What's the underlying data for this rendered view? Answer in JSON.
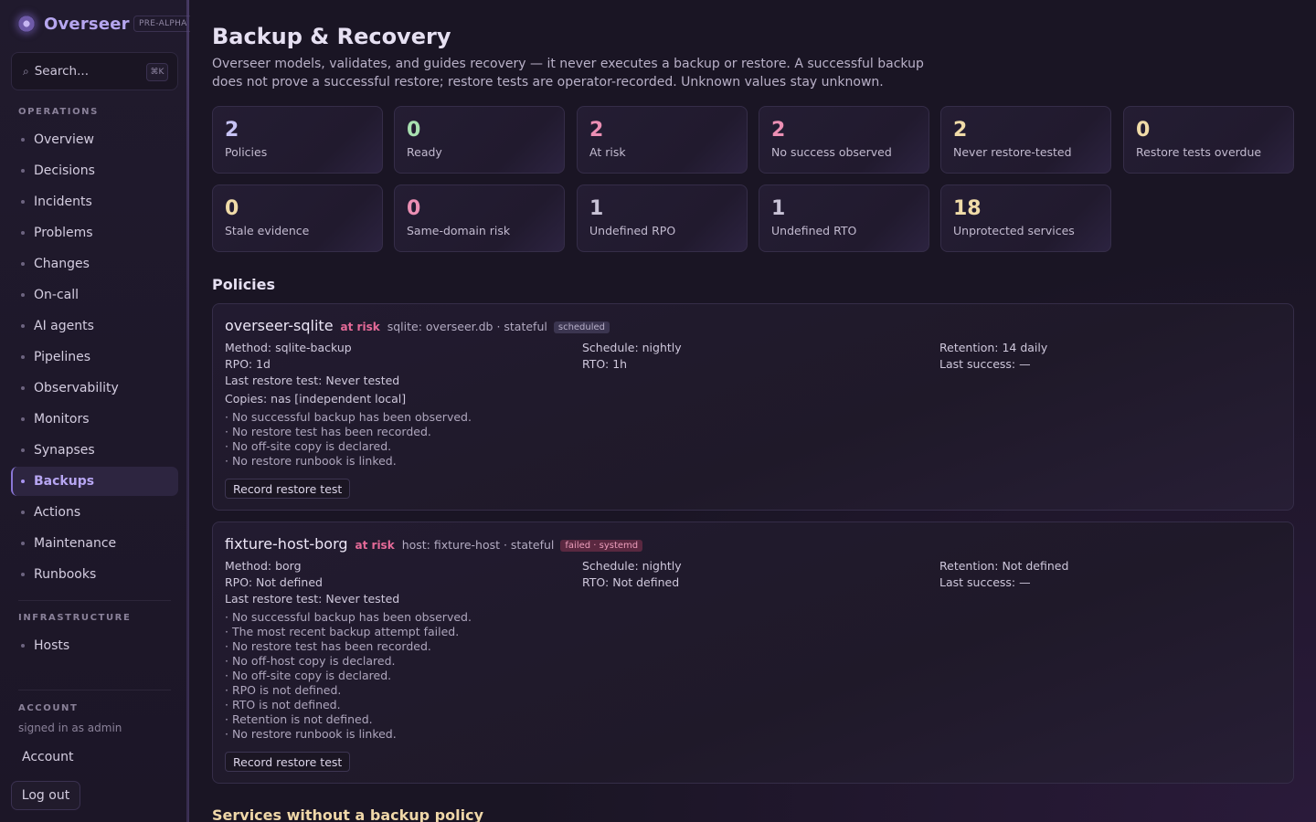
{
  "app": {
    "name": "Overseer",
    "badge": "PRE-ALPHA"
  },
  "search": {
    "placeholder": "Search...",
    "shortcut": "⌘K"
  },
  "sidebar": {
    "operations_label": "OPERATIONS",
    "operations": [
      {
        "label": "Overview"
      },
      {
        "label": "Decisions"
      },
      {
        "label": "Incidents"
      },
      {
        "label": "Problems"
      },
      {
        "label": "Changes"
      },
      {
        "label": "On-call"
      },
      {
        "label": "AI agents"
      },
      {
        "label": "Pipelines"
      },
      {
        "label": "Observability"
      },
      {
        "label": "Monitors"
      },
      {
        "label": "Synapses"
      },
      {
        "label": "Backups"
      },
      {
        "label": "Actions"
      },
      {
        "label": "Maintenance"
      },
      {
        "label": "Runbooks"
      }
    ],
    "infrastructure_label": "INFRASTRUCTURE",
    "infrastructure": [
      {
        "label": "Hosts"
      }
    ],
    "account_label": "ACCOUNT",
    "signed_in": "signed in as admin",
    "account_link": "Account",
    "logout": "Log out"
  },
  "page": {
    "title": "Backup & Recovery",
    "description": "Overseer models, validates, and guides recovery — it never executes a backup or restore. A successful backup does not prove a successful restore; restore tests are operator-recorded. Unknown values stay unknown."
  },
  "colors": {
    "accent": "#b6a6ef",
    "blue": "#c7c3f5",
    "green": "#a8e0b0",
    "pink": "#ec8fb4",
    "yellow": "#f0dba8",
    "gray": "#c8c2d6",
    "risk": "#e56a98"
  },
  "stats": [
    {
      "value": "2",
      "label": "Policies"
    },
    {
      "value": "0",
      "label": "Ready"
    },
    {
      "value": "2",
      "label": "At risk"
    },
    {
      "value": "2",
      "label": "No success observed"
    },
    {
      "value": "2",
      "label": "Never restore-tested"
    },
    {
      "value": "0",
      "label": "Restore tests overdue"
    },
    {
      "value": "0",
      "label": "Stale evidence"
    },
    {
      "value": "0",
      "label": "Same-domain risk"
    },
    {
      "value": "1",
      "label": "Undefined RPO"
    },
    {
      "value": "1",
      "label": "Undefined RTO"
    },
    {
      "value": "18",
      "label": "Unprotected services"
    }
  ],
  "policies_heading": "Policies",
  "policies": [
    {
      "name": "overseer-sqlite",
      "status": "at risk",
      "target": "sqlite: overseer.db · stateful",
      "tag": "scheduled",
      "method": "Method: sqlite-backup",
      "schedule": "Schedule: nightly",
      "retention": "Retention: 14 daily",
      "rpo": "RPO: 1d",
      "rto": "RTO: 1h",
      "last_success": "Last success: —",
      "last_restore": "Last restore test: Never tested",
      "copies": "Copies: nas [independent local]",
      "issues": [
        "· No successful backup has been observed.",
        "· No restore test has been recorded.",
        "· No off-site copy is declared.",
        "· No restore runbook is linked."
      ],
      "button": "Record restore test"
    },
    {
      "name": "fixture-host-borg",
      "status": "at risk",
      "target": "host: fixture-host · stateful",
      "tag": "failed · systemd",
      "method": "Method: borg",
      "schedule": "Schedule: nightly",
      "retention": "Retention: Not defined",
      "rpo": "RPO: Not defined",
      "rto": "RTO: Not defined",
      "last_success": "Last success: —",
      "last_restore": "Last restore test: Never tested",
      "issues": [
        "· No successful backup has been observed.",
        "· The most recent backup attempt failed.",
        "· No restore test has been recorded.",
        "· No off-host copy is declared.",
        "· No off-site copy is declared.",
        "· RPO is not defined.",
        "· RTO is not defined.",
        "· Retention is not defined.",
        "· No restore runbook is linked."
      ],
      "button": "Record restore test"
    }
  ],
  "unprotected_heading": "Services without a backup policy"
}
